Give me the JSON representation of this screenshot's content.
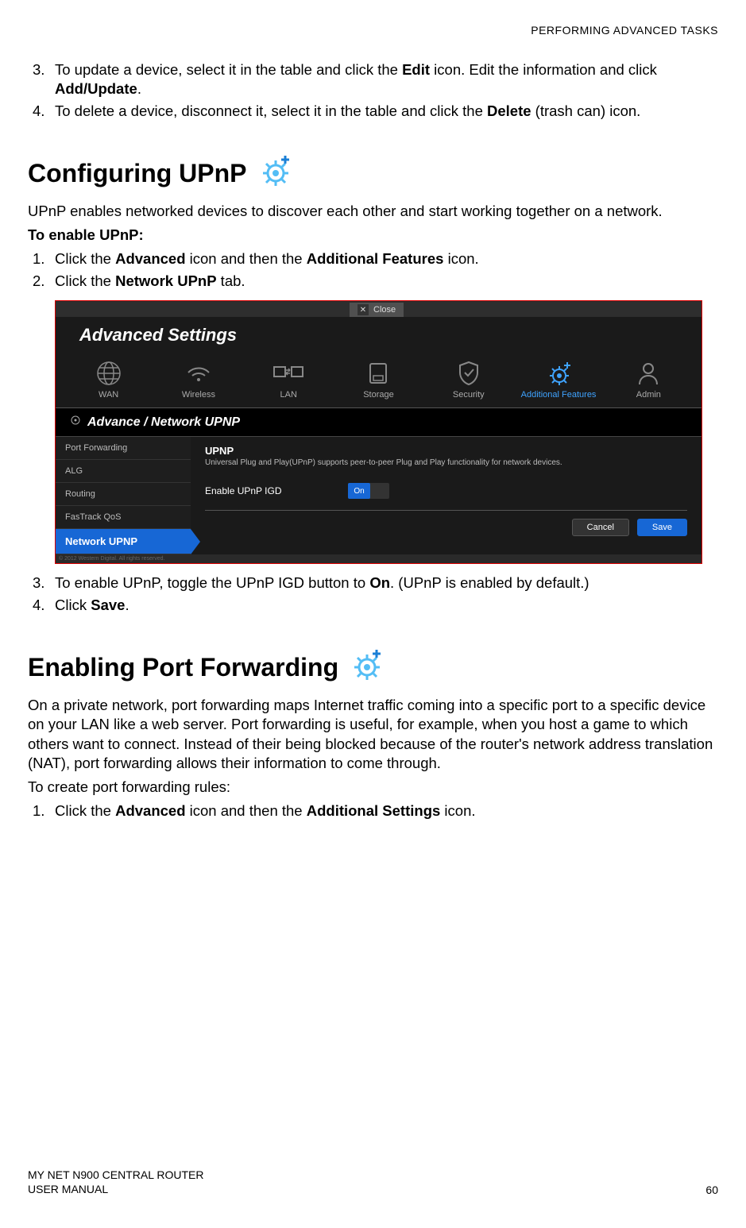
{
  "header": {
    "right": "PERFORMING ADVANCED TASKS"
  },
  "intro_steps": [
    {
      "num": "3.",
      "fragments": [
        "To update a device, select it in the table and click the ",
        "Edit",
        " icon. Edit the information and click ",
        "Add/Update",
        "."
      ]
    },
    {
      "num": "4.",
      "fragments": [
        "To delete a device, disconnect it, select it in the table and click the ",
        "Delete",
        " (trash can) icon."
      ]
    }
  ],
  "upnp_section": {
    "title": "Configuring UPnP",
    "intro": "UPnP enables networked devices to discover each other and start working together on a network.",
    "subhead": "To enable UPnP:",
    "steps_top": [
      {
        "num": "1.",
        "fragments": [
          "Click the ",
          "Advanced",
          " icon and then the ",
          "Additional Features",
          " icon."
        ]
      },
      {
        "num": "2.",
        "fragments": [
          "Click the ",
          "Network UPnP",
          " tab."
        ]
      }
    ],
    "steps_bottom": [
      {
        "num": "3.",
        "fragments": [
          "To enable UPnP, toggle the UPnP IGD button to ",
          "On",
          ". (UPnP is enabled by default.)"
        ]
      },
      {
        "num": "4.",
        "fragments": [
          "Click ",
          "Save",
          "."
        ]
      }
    ]
  },
  "screenshot": {
    "close": "Close",
    "title": "Advanced Settings",
    "tabs": [
      "WAN",
      "Wireless",
      "LAN",
      "Storage",
      "Security",
      "Additional Features",
      "Admin"
    ],
    "active_tab": 5,
    "section_bar": "Advance / Network UPNP",
    "sidebar": [
      "Port Forwarding",
      "ALG",
      "Routing",
      "FasTrack QoS",
      "Network UPNP"
    ],
    "active_side": 4,
    "panel": {
      "heading": "UPNP",
      "desc": "Universal Plug and Play(UPnP) supports peer-to-peer Plug and Play functionality for network devices.",
      "toggle_label": "Enable UPnP IGD",
      "toggle_on": "On",
      "cancel": "Cancel",
      "save": "Save"
    },
    "copyright": "© 2012 Western Digital. All rights reserved."
  },
  "portfwd_section": {
    "title": "Enabling Port Forwarding",
    "intro": "On a private network, port forwarding maps Internet traffic coming into a specific port to a specific device on your LAN like a web server. Port forwarding is useful, for example, when you host a game to which others want to connect. Instead of their being blocked because of the router's network address translation (NAT), port forwarding allows their information to come through.",
    "sub": "To create port forwarding rules:",
    "steps": [
      {
        "num": "1.",
        "fragments": [
          "Click the ",
          "Advanced",
          " icon and then the ",
          "Additional Settings",
          " icon."
        ]
      }
    ]
  },
  "footer": {
    "line1": "MY NET N900 CENTRAL ROUTER",
    "line2": "USER MANUAL",
    "page": "60"
  }
}
